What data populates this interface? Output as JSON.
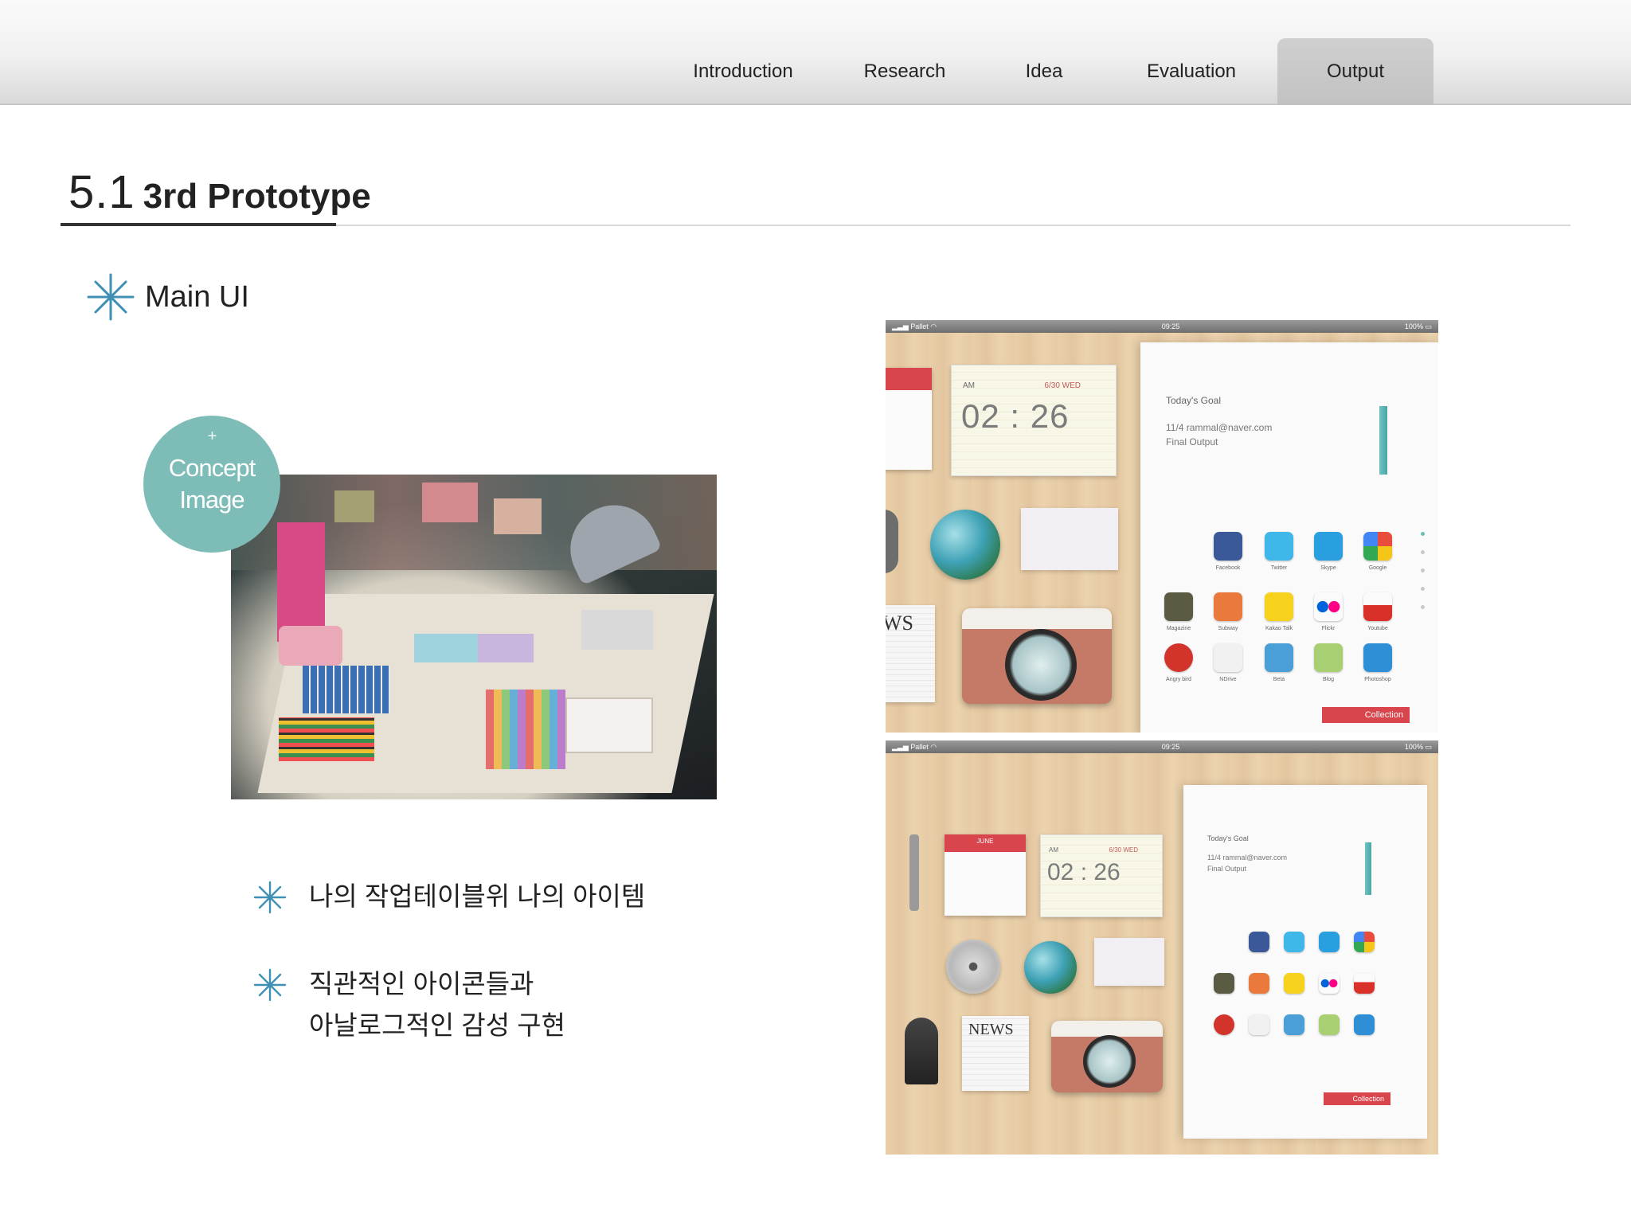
{
  "nav": {
    "tabs": [
      {
        "label": "Introduction"
      },
      {
        "label": "Research"
      },
      {
        "label": "Idea"
      },
      {
        "label": "Evaluation"
      },
      {
        "label": "Output",
        "active": true
      }
    ]
  },
  "section": {
    "number": "5.1",
    "title": "3rd Prototype"
  },
  "subsection": {
    "title": "Main UI"
  },
  "concept": {
    "badge_line1": "Concept",
    "badge_line2": "Image"
  },
  "bullets": [
    {
      "line1": "나의 작업테이블위 나의 아이템"
    },
    {
      "line1": "직관적인 아이콘들과",
      "line2": "아날로그적인 감성 구현"
    }
  ],
  "mockup_top": {
    "status_left": "Pallet",
    "status_time": "09:25",
    "status_battery": "100%",
    "clock_ampm": "AM",
    "clock_date": "6/30 WED",
    "clock_time": "02 : 26",
    "goal_title": "Today's Goal",
    "goal_line1": "11/4 rammal@naver.com",
    "goal_line2": "Final Output",
    "news_label": "WS",
    "collection_label": "Collection",
    "apps_row1": [
      "Facebook",
      "Twitter",
      "Skype",
      "Google"
    ],
    "apps_row2": [
      "Magazine",
      "Subway",
      "Kakao Talk",
      "Flickr",
      "Youtube"
    ],
    "apps_row3": [
      "Angry bird",
      "NDrive",
      "Beta",
      "Blog",
      "Photoshop"
    ]
  },
  "mockup_bottom": {
    "status_left": "Pallet",
    "status_time": "09:25",
    "status_battery": "100%",
    "cal_month": "JUNE",
    "clock_ampm": "AM",
    "clock_date": "6/30 WED",
    "clock_time": "02 : 26",
    "goal_title": "Today's Goal",
    "goal_line1": "11/4 rammal@naver.com",
    "goal_line2": "Final Output",
    "news_label": "NEWS",
    "collection_label": "Collection"
  },
  "colors": {
    "accent": "#7ebdb7",
    "asterisk": "#3f90b4",
    "ribbon": "#d9454d",
    "nav_active": "#c6c6c6"
  },
  "icons": [
    "asterisk-icon",
    "signal-icon",
    "wifi-icon",
    "battery-icon"
  ]
}
